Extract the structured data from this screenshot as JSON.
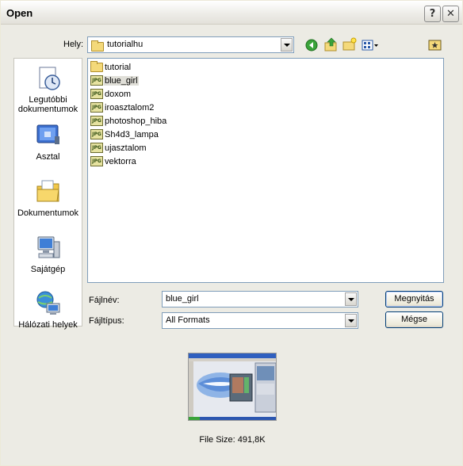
{
  "window": {
    "title": "Open"
  },
  "titlebar": {
    "help_label": "?",
    "close_label": "✕"
  },
  "location": {
    "label": "Hely:",
    "value": "tutorialhu"
  },
  "toolbar": {
    "icons": [
      "back-icon",
      "up-folder-icon",
      "new-folder-icon",
      "view-menu-icon"
    ],
    "right_icon": "favorite-folder-icon"
  },
  "places": [
    {
      "id": "recent",
      "label": "Legutóbbi dokumentumok",
      "icon": "recent-documents-icon"
    },
    {
      "id": "desktop",
      "label": "Asztal",
      "icon": "desktop-icon"
    },
    {
      "id": "documents",
      "label": "Dokumentumok",
      "icon": "my-documents-icon"
    },
    {
      "id": "computer",
      "label": "Sajátgép",
      "icon": "my-computer-icon"
    },
    {
      "id": "network",
      "label": "Hálózati helyek",
      "icon": "network-places-icon"
    }
  ],
  "files": [
    {
      "name": "tutorial",
      "type": "folder"
    },
    {
      "name": "blue_girl",
      "type": "jpg",
      "selected": true
    },
    {
      "name": "doxom",
      "type": "jpg"
    },
    {
      "name": "iroasztalom2",
      "type": "jpg"
    },
    {
      "name": "photoshop_hiba",
      "type": "jpg"
    },
    {
      "name": "Sh4d3_lampa",
      "type": "jpg"
    },
    {
      "name": "ujasztalom",
      "type": "jpg"
    },
    {
      "name": "vektorra",
      "type": "jpg"
    }
  ],
  "jpg_badge": "JPG",
  "filename": {
    "label": "Fájlnév:",
    "value": "blue_girl"
  },
  "filetype": {
    "label": "Fájltípus:",
    "value": "All Formats"
  },
  "buttons": {
    "open": "Megnyitás",
    "cancel": "Mégse"
  },
  "preview": {
    "file_size": "File Size: 491,8K"
  },
  "colors": {
    "accent": "#003c74",
    "selection": "#e0dfd8",
    "window_bg": "#ecebe4"
  }
}
